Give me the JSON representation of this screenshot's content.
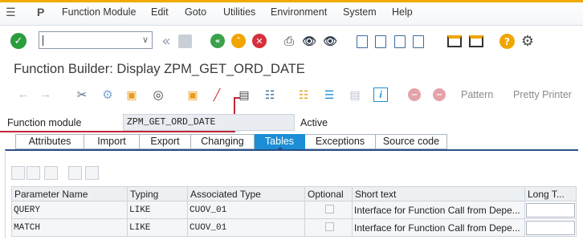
{
  "menu": {
    "items": [
      "Function Module",
      "Edit",
      "Goto",
      "Utilities",
      "Environment",
      "System",
      "Help"
    ]
  },
  "command_field": {
    "value": ""
  },
  "title": "Function Builder: Display ZPM_GET_ORD_DATE",
  "app_toolbar": {
    "pattern_label": "Pattern",
    "pretty_printer_label": "Pretty Printer"
  },
  "function_module": {
    "label": "Function module",
    "value": "ZPM_GET_ORD_DATE",
    "status": "Active"
  },
  "tabs": [
    "Attributes",
    "Import",
    "Export",
    "Changing",
    "Tables",
    "Exceptions",
    "Source code"
  ],
  "active_tab": "Tables",
  "table": {
    "columns": [
      "Parameter Name",
      "Typing",
      "Associated Type",
      "Optional",
      "Short text",
      "Long T..."
    ],
    "rows": [
      {
        "name": "QUERY",
        "typing": "LIKE",
        "type": "CUOV_01",
        "optional": "",
        "short_text": "Interface for Function Call from Depe..."
      },
      {
        "name": "MATCH",
        "typing": "LIKE",
        "type": "CUOV_01",
        "optional": "",
        "short_text": "Interface for Function Call from Depe..."
      }
    ]
  },
  "colors": {
    "accent": "#f0ab00",
    "active_tab": "#1c8ed6",
    "highlight_box": "#c0283a"
  },
  "icons": {
    "standard_toolbar": [
      "enter-icon",
      "back-icon",
      "save-icon",
      "back-green-icon",
      "exit-icon",
      "cancel-icon",
      "print-icon",
      "find-icon",
      "find-next-icon",
      "first-page-icon",
      "previous-page-icon",
      "next-page-icon",
      "last-page-icon",
      "new-session-icon",
      "shortcut-icon",
      "help-icon",
      "settings-icon"
    ],
    "app_toolbar": [
      "back-arrow-icon",
      "forward-arrow-icon",
      "other-object-icon",
      "display-change-icon",
      "activate-icon",
      "check-icon",
      "test-icon",
      "where-used-icon",
      "display-object-list-icon",
      "navigation-window-icon",
      "hierarchy-icon",
      "function-group-icon",
      "documentation-icon",
      "info-icon",
      "breakpoint-icon",
      "external-breakpoint-icon"
    ]
  }
}
